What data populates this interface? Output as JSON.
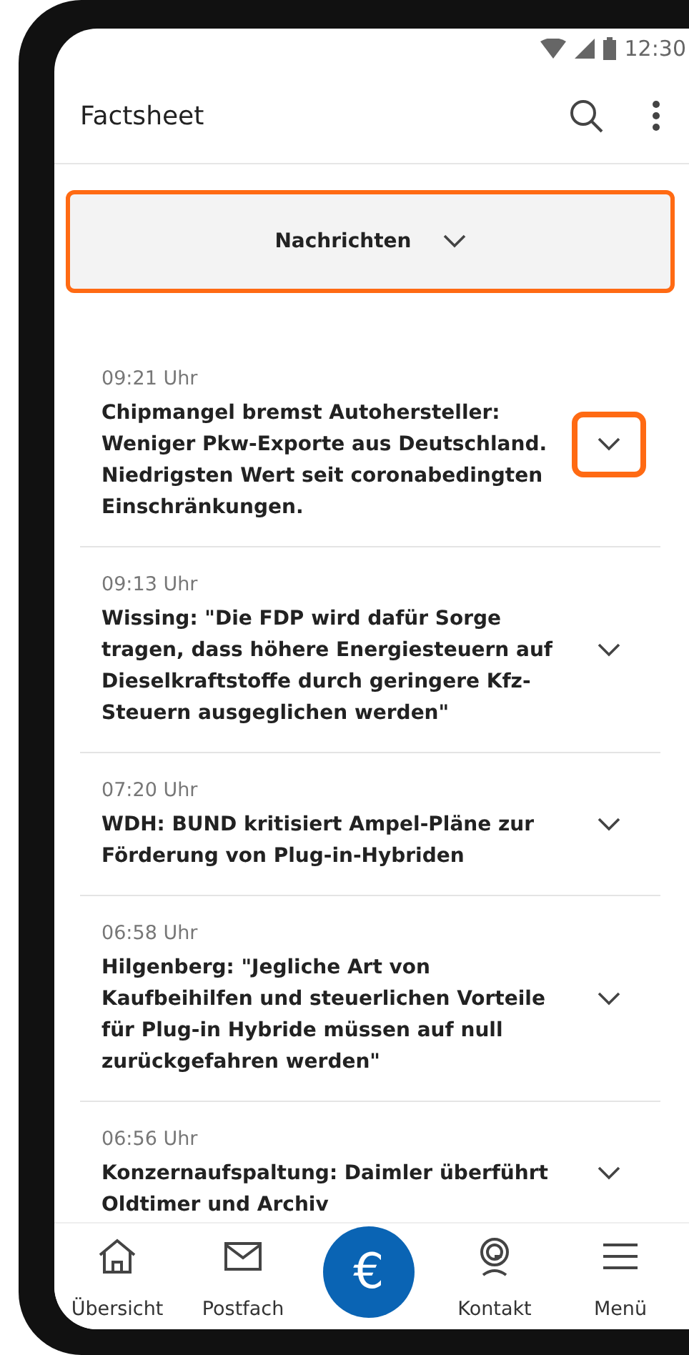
{
  "status_bar": {
    "time": "12:30"
  },
  "app_bar": {
    "title": "Factsheet"
  },
  "category_dropdown": {
    "label": "Nachrichten",
    "highlighted": true
  },
  "news": [
    {
      "time": "09:21 Uhr",
      "headline": "Chipmangel bremst Autohersteller: Weniger Pkw-Exporte aus Deutschland. Niedrigsten Wert seit coronabedingten Einschränkungen.",
      "highlighted": true
    },
    {
      "time": "09:13 Uhr",
      "headline": "Wissing: \"Die FDP wird dafür Sorge tragen, dass höhere Energiesteuern auf Dieselkraftstoffe durch geringere Kfz-Steuern ausgeglichen werden\"",
      "highlighted": false
    },
    {
      "time": "07:20 Uhr",
      "headline": "WDH: BUND kritisiert Ampel-Pläne zur Förderung von Plug-in-Hybriden",
      "highlighted": false
    },
    {
      "time": "06:58 Uhr",
      "headline": "Hilgenberg: \"Jegliche Art von Kaufbeihilfen und steuerlichen Vorteile für Plug-in Hybride müssen auf null zurückgefahren werden\"",
      "highlighted": false
    },
    {
      "time": "06:56 Uhr",
      "headline": "Konzernaufspaltung: Daimler überführt Oldtimer und Archiv",
      "highlighted": false
    }
  ],
  "bottom_nav": [
    {
      "kind": "home",
      "label": "Übersicht"
    },
    {
      "kind": "mail",
      "label": "Postfach"
    },
    {
      "kind": "euro",
      "label": "€"
    },
    {
      "kind": "contact",
      "label": "Kontakt"
    },
    {
      "kind": "menu",
      "label": "Menü"
    }
  ]
}
